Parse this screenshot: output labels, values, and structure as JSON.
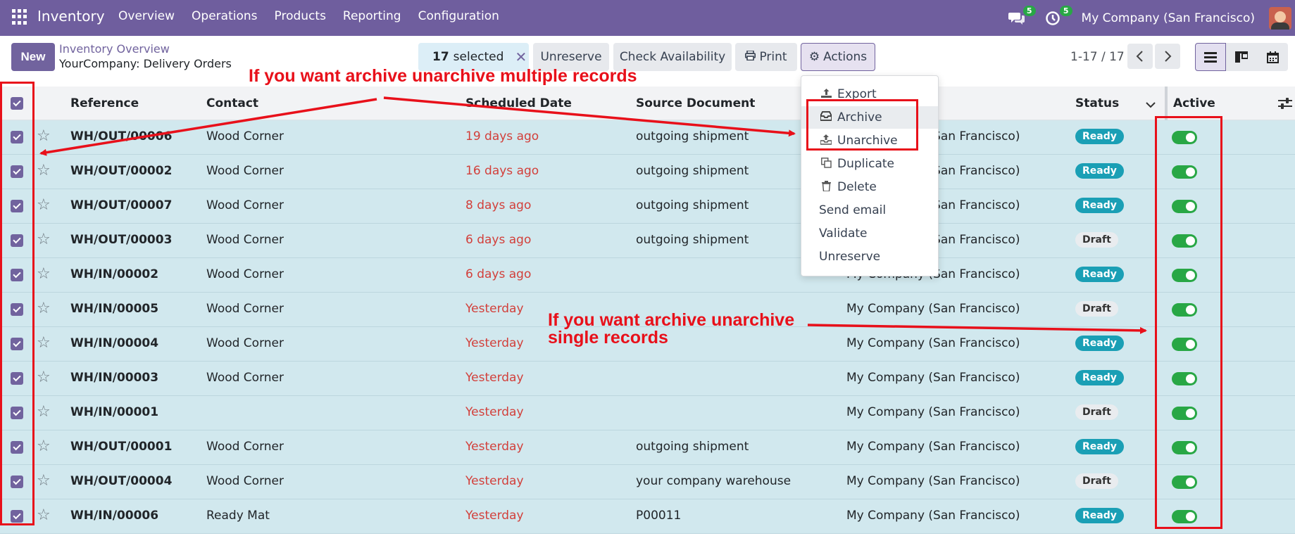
{
  "topnav": {
    "app_name": "Inventory",
    "menu": [
      "Overview",
      "Operations",
      "Products",
      "Reporting",
      "Configuration"
    ],
    "messages_count": "5",
    "activities_count": "5",
    "company": "My Company (San Francisco)",
    "nav_color": "#6f5e9e"
  },
  "control": {
    "new_label": "New",
    "breadcrumb_parent": "Inventory Overview",
    "breadcrumb_current": "YourCompany: Delivery Orders",
    "selected_count": "17",
    "selected_label": "selected",
    "unreserve_label": "Unreserve",
    "check_availability_label": "Check Availability",
    "print_label": "Print",
    "actions_label": "Actions",
    "pager_text": "1-17 / 17"
  },
  "table": {
    "headers": {
      "reference": "Reference",
      "contact": "Contact",
      "scheduled_date": "Scheduled Date",
      "source_document": "Source Document",
      "status": "Status",
      "active": "Active"
    },
    "rows": [
      {
        "reference": "WH/OUT/00006",
        "contact": "Wood Corner",
        "date": "19 days ago",
        "source": "outgoing shipment",
        "company": "My Company (San Francisco)",
        "status": "Ready",
        "active": true
      },
      {
        "reference": "WH/OUT/00002",
        "contact": "Wood Corner",
        "date": "16 days ago",
        "source": "outgoing shipment",
        "company": "My Company (San Francisco)",
        "status": "Ready",
        "active": true
      },
      {
        "reference": "WH/OUT/00007",
        "contact": "Wood Corner",
        "date": "8 days ago",
        "source": "outgoing shipment",
        "company": "My Company (San Francisco)",
        "status": "Ready",
        "active": true
      },
      {
        "reference": "WH/OUT/00003",
        "contact": "Wood Corner",
        "date": "6 days ago",
        "source": "outgoing shipment",
        "company": "My Company (San Francisco)",
        "status": "Draft",
        "active": true
      },
      {
        "reference": "WH/IN/00002",
        "contact": "Wood Corner",
        "date": "6 days ago",
        "source": "",
        "company": "My Company (San Francisco)",
        "status": "Ready",
        "active": true
      },
      {
        "reference": "WH/IN/00005",
        "contact": "Wood Corner",
        "date": "Yesterday",
        "source": "",
        "company": "My Company (San Francisco)",
        "status": "Draft",
        "active": true
      },
      {
        "reference": "WH/IN/00004",
        "contact": "Wood Corner",
        "date": "Yesterday",
        "source": "",
        "company": "My Company (San Francisco)",
        "status": "Ready",
        "active": true
      },
      {
        "reference": "WH/IN/00003",
        "contact": "Wood Corner",
        "date": "Yesterday",
        "source": "",
        "company": "My Company (San Francisco)",
        "status": "Ready",
        "active": true
      },
      {
        "reference": "WH/IN/00001",
        "contact": "",
        "date": "Yesterday",
        "source": "",
        "company": "My Company (San Francisco)",
        "status": "Draft",
        "active": true
      },
      {
        "reference": "WH/OUT/00001",
        "contact": "Wood Corner",
        "date": "Yesterday",
        "source": "outgoing shipment",
        "company": "My Company (San Francisco)",
        "status": "Ready",
        "active": true
      },
      {
        "reference": "WH/OUT/00004",
        "contact": "Wood Corner",
        "date": "Yesterday",
        "source": "your company warehouse",
        "company": "My Company (San Francisco)",
        "status": "Draft",
        "active": true
      },
      {
        "reference": "WH/IN/00006",
        "contact": "Ready Mat",
        "date": "Yesterday",
        "source": "P00011",
        "company": "My Company (San Francisco)",
        "status": "Ready",
        "active": true
      }
    ]
  },
  "actions_menu": {
    "export": "Export",
    "archive": "Archive",
    "unarchive": "Unarchive",
    "duplicate": "Duplicate",
    "delete": "Delete",
    "send_email": "Send email",
    "validate": "Validate",
    "unreserve": "Unreserve"
  },
  "annotations": {
    "multiple": "If you want archive unarchive multiple records",
    "single_line1": "If you want archive unarchive",
    "single_line2": "single records",
    "color": "#e8101a"
  }
}
